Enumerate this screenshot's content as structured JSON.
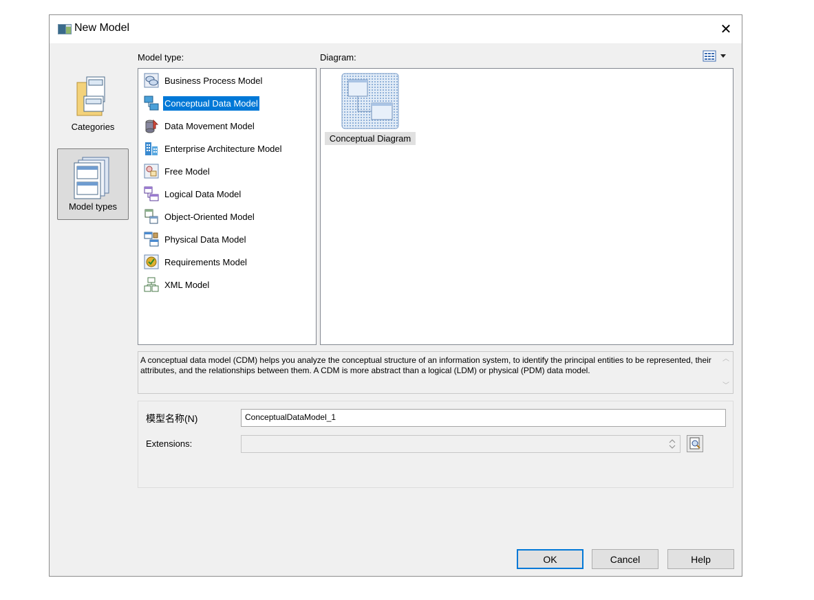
{
  "dialog": {
    "title": "New Model",
    "close_symbol": "✕"
  },
  "categories": [
    {
      "label": "Categories",
      "icon": "folder-form-icon",
      "selected": false
    },
    {
      "label": "Model types",
      "icon": "stacked-forms-icon",
      "selected": true
    }
  ],
  "model_type": {
    "label": "Model type:",
    "items": [
      {
        "label": "Business Process Model",
        "icon": "business-process-icon"
      },
      {
        "label": "Conceptual Data Model",
        "icon": "conceptual-data-icon",
        "selected": true
      },
      {
        "label": "Data Movement Model",
        "icon": "data-movement-icon"
      },
      {
        "label": "Enterprise Architecture Model",
        "icon": "enterprise-architecture-icon"
      },
      {
        "label": "Free Model",
        "icon": "free-model-icon"
      },
      {
        "label": "Logical Data Model",
        "icon": "logical-data-icon"
      },
      {
        "label": "Object-Oriented Model",
        "icon": "object-oriented-icon"
      },
      {
        "label": "Physical Data Model",
        "icon": "physical-data-icon"
      },
      {
        "label": "Requirements Model",
        "icon": "requirements-icon"
      },
      {
        "label": "XML Model",
        "icon": "xml-model-icon"
      }
    ]
  },
  "diagram": {
    "label": "Diagram:",
    "view_toggle_icon": "grid-view-icon",
    "items": [
      {
        "label": "Conceptual Diagram",
        "icon": "conceptual-diagram-icon",
        "selected": true
      }
    ]
  },
  "description": "A conceptual data model (CDM) helps you analyze the conceptual structure of an information system, to identify the principal entities to be represented, their attributes, and the relationships between them. A CDM is more abstract than a logical (LDM) or physical (PDM) data model.",
  "form": {
    "name_label": "模型名称(N)",
    "name_value": "ConceptualDataModel_1",
    "extensions_label": "Extensions:",
    "extensions_value": ""
  },
  "buttons": {
    "ok": "OK",
    "cancel": "Cancel",
    "help": "Help"
  },
  "colors": {
    "selection": "#0078d7",
    "dialog_bg": "#f0f0f0"
  }
}
